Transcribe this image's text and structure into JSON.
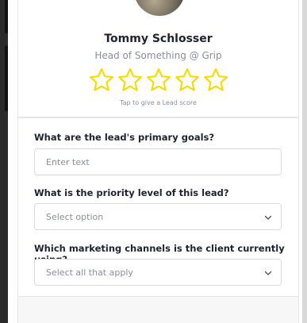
{
  "profile": {
    "name": "Tommy Schlosser",
    "title": "Head of Something @ Grip",
    "star_count": 5,
    "star_color": "#f5dc00",
    "tap_hint": "Tap to give a Lead score"
  },
  "questions": [
    {
      "label": "What are the lead's primary goals?",
      "placeholder": "Enter text",
      "type": "text"
    },
    {
      "label": "What is the priority level of this lead?",
      "placeholder": "Select option",
      "type": "select"
    },
    {
      "label": "Which marketing channels is the client currently using?",
      "placeholder": "Select all that apply",
      "type": "multiselect"
    }
  ],
  "icons": {
    "star": "star-outline-icon",
    "chevron": "chevron-down-icon"
  }
}
